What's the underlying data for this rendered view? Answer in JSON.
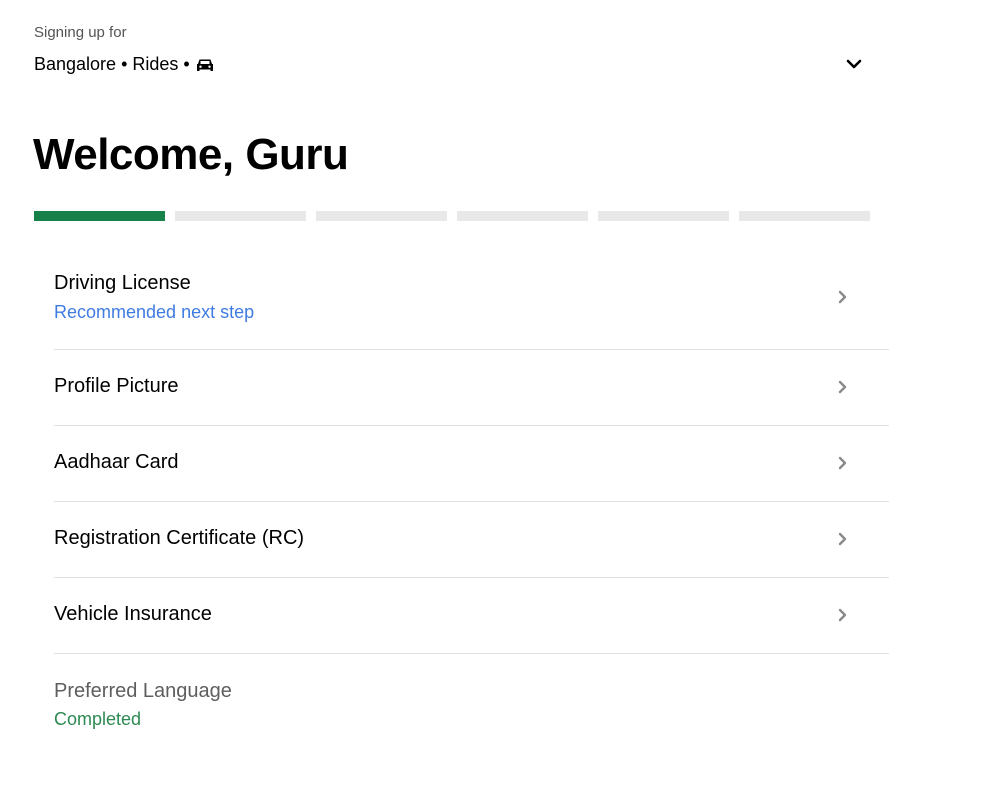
{
  "header": {
    "signing_up_label": "Signing up for",
    "city_selection": "Bangalore • Rides •",
    "vehicle_icon": "car-icon",
    "dropdown_icon": "chevron-down-icon"
  },
  "welcome_title": "Welcome, Guru",
  "progress": {
    "total_steps": 6,
    "completed_steps": 1,
    "active_color": "#188149",
    "inactive_color": "#e8e8e8"
  },
  "steps": [
    {
      "title": "Driving License",
      "subtitle": "Recommended next step",
      "subtitle_color": "#3f7be0"
    },
    {
      "title": "Profile Picture"
    },
    {
      "title": "Aadhaar Card"
    },
    {
      "title": "Registration Certificate (RC)"
    },
    {
      "title": "Vehicle Insurance"
    },
    {
      "title": "Preferred Language",
      "subtitle": "Completed",
      "subtitle_color": "#2c8a52"
    }
  ]
}
